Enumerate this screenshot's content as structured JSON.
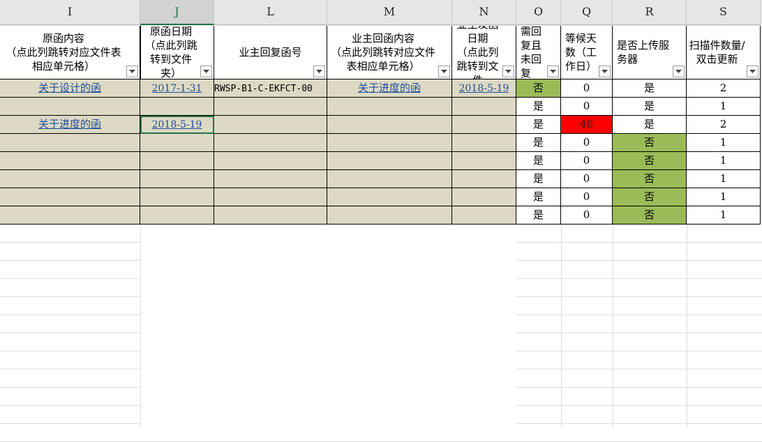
{
  "columns": [
    "I",
    "J",
    "L",
    "M",
    "N",
    "O",
    "Q",
    "R",
    "S"
  ],
  "selected_column": "J",
  "headers": {
    "I": "原函内容\n（点此列跳转对应文件表相应单元格）",
    "J": "原函日期\n（点此列跳转到文件夹）",
    "L": "业主回复函号",
    "M": "业主回函内容\n（点此列跳转对应文件表相应单元格）",
    "N": "业主发函日期\n（点此列跳转到文件",
    "O": "需回复且未回复",
    "Q": "等候天数（工作日）",
    "R": "是否上传服务器",
    "S": "扫描件数量/双击更新"
  },
  "rows": [
    {
      "I": "关于设计的函",
      "J": "2017-1-31",
      "L": "RWSP-B1-C-EKFCT-00",
      "M": "关于进度的函",
      "N": "2018-5-19",
      "O": "否",
      "Q": "0",
      "R": "是",
      "S": "2"
    },
    {
      "I": "",
      "J": "",
      "L": "",
      "M": "",
      "N": "",
      "O": "是",
      "Q": "0",
      "R": "是",
      "S": "1"
    },
    {
      "I": "关于进度的函",
      "J": "2018-5-19",
      "L": "",
      "M": "",
      "N": "",
      "O": "是",
      "Q": "46",
      "R": "是",
      "S": "2"
    },
    {
      "I": "",
      "J": "",
      "L": "",
      "M": "",
      "N": "",
      "O": "是",
      "Q": "0",
      "R": "否",
      "S": "1"
    },
    {
      "I": "",
      "J": "",
      "L": "",
      "M": "",
      "N": "",
      "O": "是",
      "Q": "0",
      "R": "否",
      "S": "1"
    },
    {
      "I": "",
      "J": "",
      "L": "",
      "M": "",
      "N": "",
      "O": "是",
      "Q": "0",
      "R": "否",
      "S": "1"
    },
    {
      "I": "",
      "J": "",
      "L": "",
      "M": "",
      "N": "",
      "O": "是",
      "Q": "0",
      "R": "否",
      "S": "1"
    },
    {
      "I": "",
      "J": "",
      "L": "",
      "M": "",
      "N": "",
      "O": "是",
      "Q": "0",
      "R": "否",
      "S": "1"
    }
  ],
  "colors": {
    "tan": "#ddd9c4",
    "green": "#9bbb59",
    "red": "#ff0000",
    "link": "#1f4e9a",
    "selected": "#217346"
  },
  "icons": {
    "filter": "filter-dropdown-icon"
  }
}
